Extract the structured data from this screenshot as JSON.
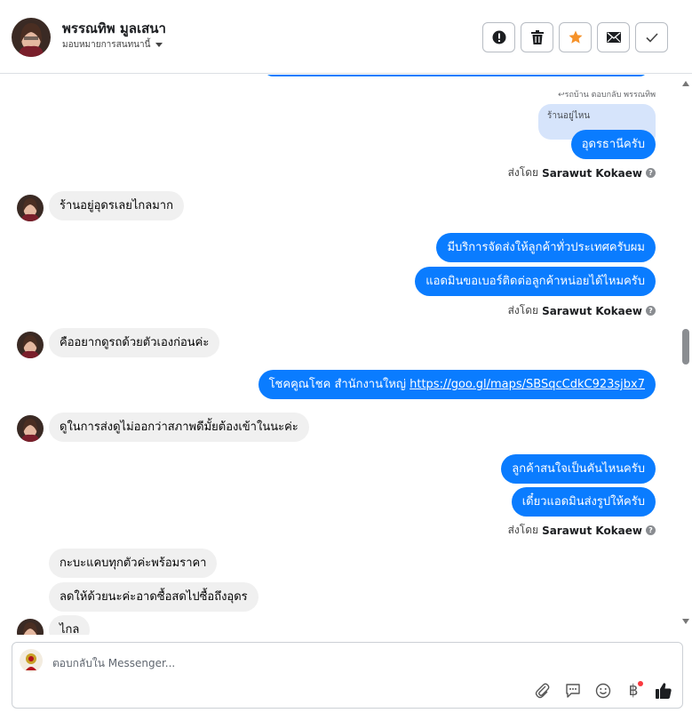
{
  "header": {
    "name": "พรรณทิพ มูลเสนา",
    "assign_label": "มอบหมายการสนทนานี้"
  },
  "messages": {
    "replied_note": "↩รถบ้าน ตอบกลับ พรรณทิพ",
    "quoted_text": "ร้านอยู่ไหน",
    "m1": "อุดรธานีครับ",
    "m2": "ร้านอยู่อุดรเลยไกลมาก",
    "m3": "มีบริการจัดส่งให้ลูกค้าทั่วประเทศครับผม",
    "m4": "แอดมินขอเบอร์ติดต่อลูกค้าหน่อยได้ไหมครับ",
    "m5": "คืออยากดูรถด้วยตัวเองก่อนค่ะ",
    "m6_text": "โชคคูณโชค สำนักงานใหญ่ ",
    "m6_link": "https://goo.gl/maps/SBSqcCdkC923sjbx7",
    "m7": "ดูในการส่งดูไม่ออกว่าสภาพดีมั้ยต้องเข้าในนะค่ะ",
    "m8": "ลูกค้าสนใจเป็นคันไหนครับ",
    "m9": "เดี๋ยวแอดมินส่งรูปให้ครับ",
    "m10": "กะบะแคบทุกตัวค่ะพร้อมราคา",
    "m11": "ลดให้ด้วยนะค่ะอาดซื้อสดไปซื้อถึงอุดร",
    "m12": "ไกล"
  },
  "sent_by": {
    "prefix": "ส่งโดย",
    "agent": "Sarawut Kokaew",
    "help": "?"
  },
  "composer": {
    "placeholder": "ตอบกลับใน Messenger...",
    "currency_symbol": "฿"
  },
  "colors": {
    "outgoing_bubble": "#0a7cff",
    "incoming_bubble": "#f0f0f0",
    "like_icon": "#1c1e21"
  },
  "icons": [
    "report-icon",
    "trash-icon",
    "star-icon",
    "mail-icon",
    "check-icon",
    "attach-icon",
    "saved-reply-icon",
    "emoji-icon",
    "baht-payment-icon",
    "thumbs-up-icon"
  ]
}
